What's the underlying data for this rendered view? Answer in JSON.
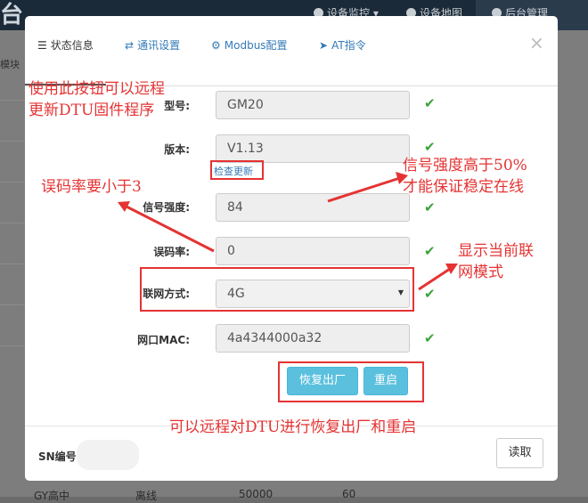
{
  "background": {
    "logo": "台",
    "nav": [
      "设备监控",
      "设备地图",
      "后台管理"
    ],
    "side_text": "模块",
    "bottom_row": [
      "GY高中",
      "离线",
      "50000",
      "60"
    ]
  },
  "modal": {
    "tabs": [
      {
        "label": "状态信息",
        "icon": "list-icon"
      },
      {
        "label": "通讯设置",
        "icon": "shuffle-icon"
      },
      {
        "label": "Modbus配置",
        "icon": "gear-icon"
      },
      {
        "label": "AT指令",
        "icon": "send-icon"
      }
    ],
    "close_label": "×",
    "fields": {
      "model": {
        "label": "型号:",
        "value": "GM20"
      },
      "version": {
        "label": "版本:",
        "value": "V1.13",
        "link": "检查更新"
      },
      "signal": {
        "label": "信号强度:",
        "value": "84"
      },
      "error_rate": {
        "label": "误码率:",
        "value": "0"
      },
      "network": {
        "label": "联网方式:",
        "value": "4G"
      },
      "mac": {
        "label": "网口MAC:",
        "value": "4a4344000a32"
      }
    },
    "check_mark": "✔",
    "buttons": {
      "factory_reset": "恢复出厂",
      "restart": "重启"
    },
    "footer": {
      "sn_label": "SN编号",
      "read_button": "读取"
    }
  },
  "annotations": {
    "update": [
      "使用此按钮可以远程",
      "更新DTU固件程序"
    ],
    "error_rate": "误码率要小于3",
    "signal": [
      "信号强度高于50%",
      "才能保证稳定在线"
    ],
    "network": [
      "显示当前联",
      "网模式"
    ],
    "reset": "可以远程对DTU进行恢复出厂和重启"
  },
  "colors": {
    "annotation": "#e53333",
    "accent": "#5bc0de",
    "check": "#3ca23c",
    "link": "#337ab7"
  }
}
